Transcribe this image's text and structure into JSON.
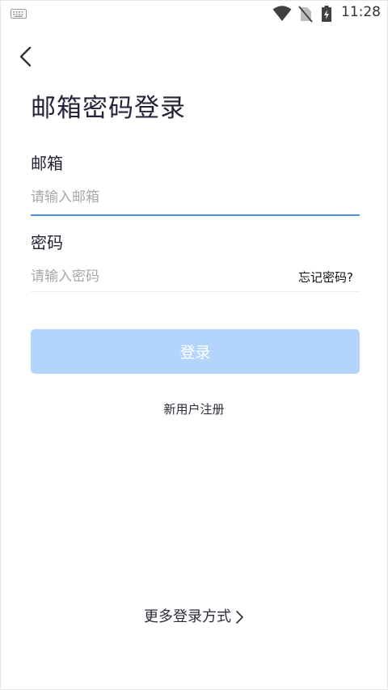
{
  "status_bar": {
    "time": "11:28",
    "icons": [
      "keyboard-icon",
      "wifi-icon",
      "no-sim-icon",
      "battery-charging-icon"
    ]
  },
  "page": {
    "back_icon": "chevron-left-icon",
    "title": "邮箱密码登录"
  },
  "form": {
    "email": {
      "label": "邮箱",
      "placeholder": "请输入邮箱",
      "value": ""
    },
    "password": {
      "label": "密码",
      "placeholder": "请输入密码",
      "value": "",
      "forgot_label": "忘记密码?"
    },
    "login_label": "登录",
    "register_label": "新用户注册"
  },
  "footer": {
    "more_login_label": "更多登录方式",
    "more_login_icon": "chevron-right-icon"
  },
  "colors": {
    "accent": "#4a94e6",
    "button_disabled": "#b3d4fc",
    "title_text": "#23233a"
  }
}
